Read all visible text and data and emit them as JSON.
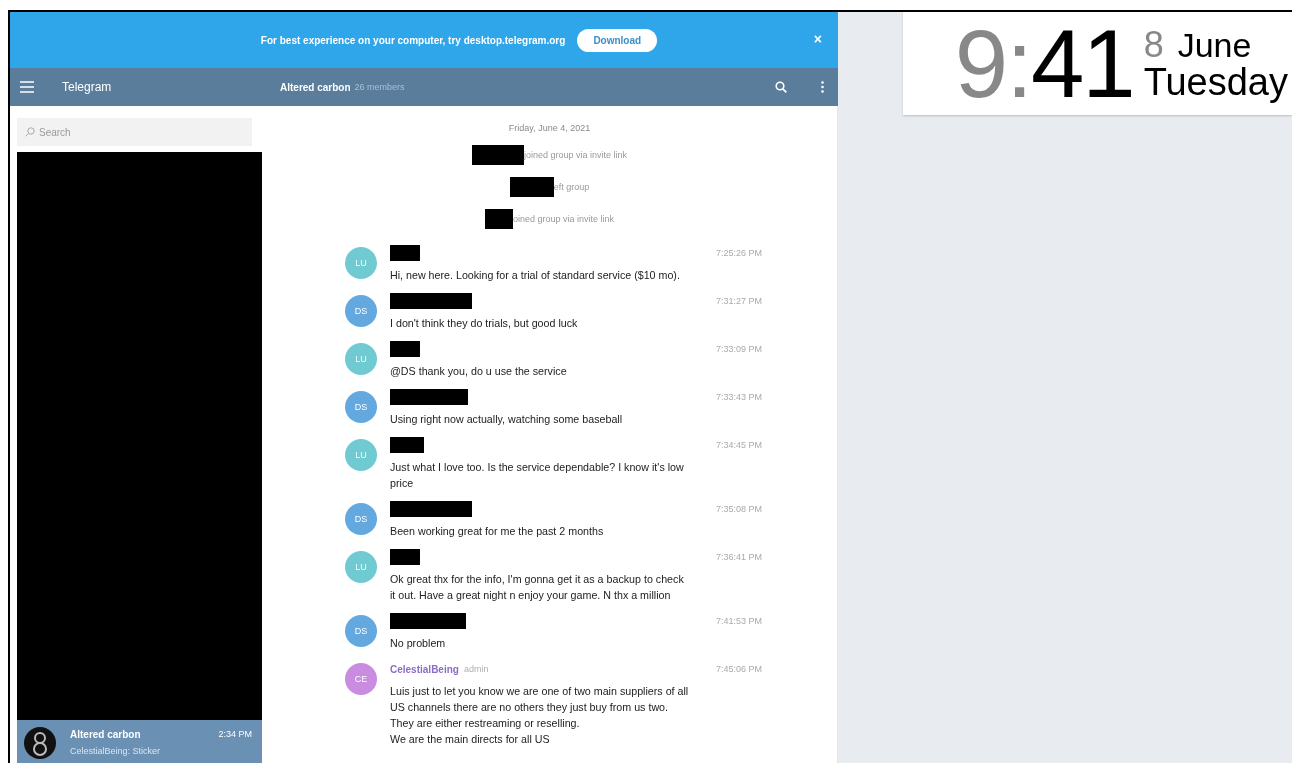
{
  "banner": {
    "text": "For best experience on your computer, try desktop.telegram.org",
    "button": "Download",
    "close": "×"
  },
  "header": {
    "app_title": "Telegram",
    "chat_title": "Altered carbon",
    "chat_subtitle": "26 members"
  },
  "sidebar": {
    "search": {
      "placeholder": "Search"
    },
    "list_redacted": true,
    "chats": [
      {
        "name": "Altered carbon",
        "time": "2:34 PM",
        "preview": "CelestialBeing: Sticker",
        "selected": true
      }
    ]
  },
  "chat": {
    "date": "Friday, June 4, 2021",
    "service_messages": [
      {
        "text": "joined group via invite link",
        "redacted": true
      },
      {
        "text": "eft group",
        "redacted": true
      },
      {
        "text": "oined group via invite link",
        "redacted": true
      }
    ],
    "messages": [
      {
        "initials": "LU",
        "color": "#6fcbd1",
        "sender_redacted": true,
        "time": "7:25:26 PM",
        "text": "Hi, new here. Looking for a trial of standard service ($10 mo)."
      },
      {
        "initials": "DS",
        "color": "#63a9e0",
        "sender_redacted": true,
        "time": "7:31:27 PM",
        "text": "I don't think they do trials, but good luck"
      },
      {
        "initials": "LU",
        "color": "#6fcbd1",
        "sender_redacted": true,
        "time": "7:33:09 PM",
        "text": "@DS thank you, do u use the service"
      },
      {
        "initials": "DS",
        "color": "#63a9e0",
        "sender_redacted": true,
        "time": "7:33:43 PM",
        "text": "Using right now actually, watching some baseball"
      },
      {
        "initials": "LU",
        "color": "#6fcbd1",
        "sender_redacted": true,
        "time": "7:34:45 PM",
        "text": "Just what I love too. Is the service dependable? I know it's low price"
      },
      {
        "initials": "DS",
        "color": "#63a9e0",
        "sender_redacted": true,
        "time": "7:35:08 PM",
        "text": "Been working great for me the past 2 months"
      },
      {
        "initials": "LU",
        "color": "#6fcbd1",
        "sender_redacted": true,
        "time": "7:36:41 PM",
        "text": "Ok great thx for the info, I'm gonna get it as a backup to check it out. Have a great night n enjoy your game. N thx a million"
      },
      {
        "initials": "DS",
        "color": "#63a9e0",
        "sender_redacted": true,
        "time": "7:41:53 PM",
        "text": "No problem"
      },
      {
        "initials": "CE",
        "color": "#c98ce0",
        "sender_redacted": false,
        "sender": "CelestialBeing",
        "role": "admin",
        "time": "7:45:06 PM",
        "text": "Luis just to let you know we are one of two main suppliers of all\nUS channels there are no others they just buy from us two.\nThey are either restreaming or reselling.\nWe are the main directs for all US"
      }
    ]
  },
  "clock": {
    "hour": "9",
    "separator": ":",
    "minute": "41",
    "day": "8",
    "month": "June",
    "weekday": "Tuesday"
  }
}
